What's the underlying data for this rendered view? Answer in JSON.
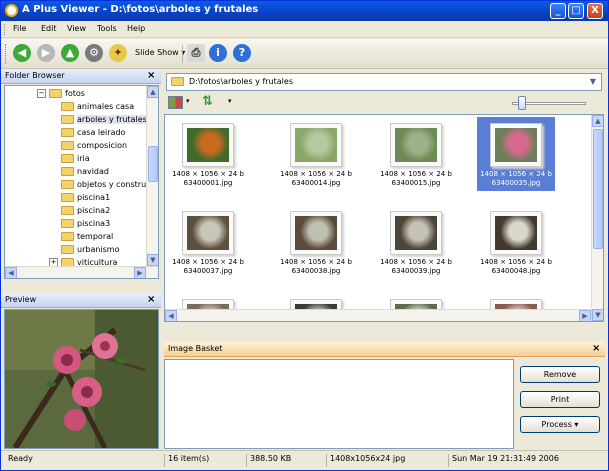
{
  "window": {
    "title": "A Plus Viewer - D:\\fotos\\arboles y frutales",
    "buttons": [
      "_",
      "□",
      "X"
    ]
  },
  "menu": [
    "File",
    "Edit",
    "View",
    "Tools",
    "Help"
  ],
  "toolbar": {
    "slideshow_label": "Slide Show",
    "icons": [
      "back-icon",
      "forward-icon",
      "up-icon",
      "settings-icon",
      "new-folder-icon",
      "print-icon",
      "info-icon",
      "help-icon"
    ]
  },
  "folder_browser": {
    "title": "Folder Browser",
    "close": "×",
    "items": [
      {
        "label": "fotos",
        "expander": "−"
      },
      {
        "label": "animales casa"
      },
      {
        "label": "arboles y frutales",
        "selected": true
      },
      {
        "label": "casa leirado"
      },
      {
        "label": "composicion"
      },
      {
        "label": "iria"
      },
      {
        "label": "navidad"
      },
      {
        "label": "objetos y constru"
      },
      {
        "label": "piscina1"
      },
      {
        "label": "piscina2"
      },
      {
        "label": "piscina3"
      },
      {
        "label": "temporal"
      },
      {
        "label": "urbanismo"
      },
      {
        "label": "viticultura",
        "expander": "+"
      }
    ]
  },
  "preview": {
    "title": "Preview",
    "close": "×"
  },
  "address": {
    "path": "D:\\fotos\\arboles y frutales"
  },
  "thumbnails": [
    {
      "dims": "1408 × 1056 × 24 b",
      "name": "63400001.jpg",
      "colors": [
        "#3f6a2a",
        "#c66a1e"
      ]
    },
    {
      "dims": "1408 × 1056 × 24 b",
      "name": "63400014.jpg",
      "colors": [
        "#8aa76a",
        "#b5c9a0"
      ]
    },
    {
      "dims": "1408 × 1056 × 24 b",
      "name": "63400015.jpg",
      "colors": [
        "#6f8b55",
        "#9fb18a"
      ]
    },
    {
      "dims": "1408 × 1056 × 24 b",
      "name": "63400035.jpg",
      "colors": [
        "#6e7e5a",
        "#d56a8e"
      ],
      "selected": true
    },
    {
      "dims": "1408 × 1056 × 24 b",
      "name": "63400037.jpg",
      "colors": [
        "#5e5040",
        "#c8c6b8"
      ]
    },
    {
      "dims": "1408 × 1056 × 24 b",
      "name": "63400038.jpg",
      "colors": [
        "#5a4b3c",
        "#bfc0b0"
      ]
    },
    {
      "dims": "1408 × 1056 × 24 b",
      "name": "63400039.jpg",
      "colors": [
        "#4d4438",
        "#c4c3b4"
      ]
    },
    {
      "dims": "1408 × 1056 × 24 b",
      "name": "63400048.jpg",
      "colors": [
        "#43392e",
        "#d9d6cc"
      ]
    },
    {
      "dims": "",
      "name": "",
      "colors": [
        "#7a6a5a",
        "#c8c0b5"
      ]
    },
    {
      "dims": "",
      "name": "",
      "colors": [
        "#3a3a32",
        "#c0bbb0"
      ]
    },
    {
      "dims": "",
      "name": "",
      "colors": [
        "#5a6a4a",
        "#cfd5c5"
      ]
    },
    {
      "dims": "",
      "name": "",
      "colors": [
        "#8a5a4e",
        "#e0c4c0"
      ]
    }
  ],
  "basket": {
    "title": "Image Basket",
    "close": "×",
    "remove_label": "Remove",
    "print_label": "Print",
    "process_label": "Process"
  },
  "status": {
    "state": "Ready",
    "items": "16 item(s)",
    "size": "388.50 KB",
    "dims": "1408x1056x24 jpg",
    "date": "Sun Mar 19 21:31:49 2006"
  },
  "colors": {
    "titlebar": "#0842c4",
    "selection": "#5a7ed6",
    "basket_header": "#f6cf93"
  }
}
